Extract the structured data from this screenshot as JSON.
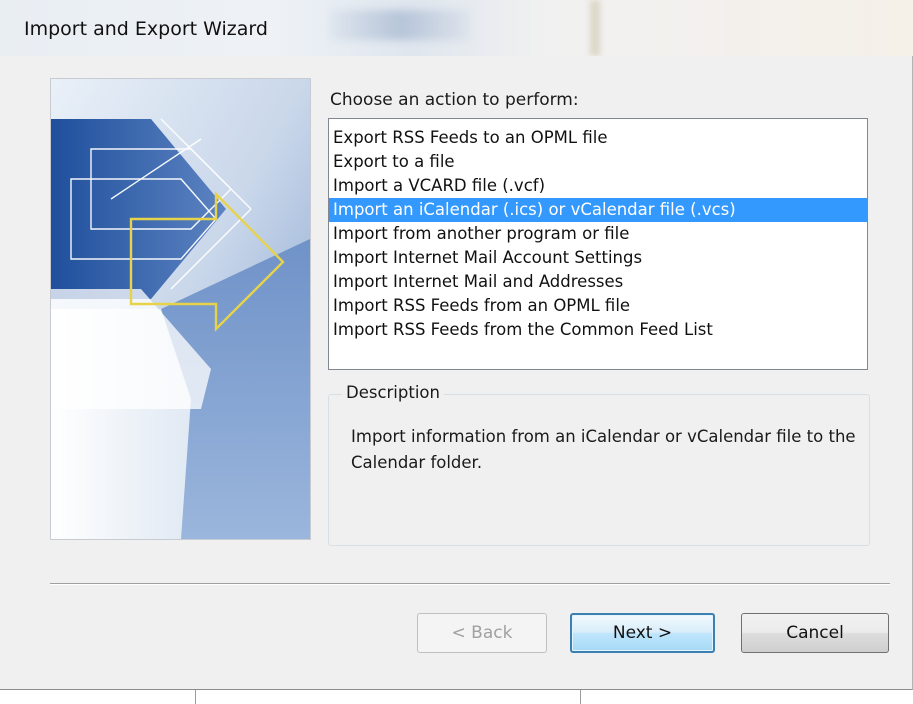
{
  "window": {
    "title": "Import and Export Wizard"
  },
  "wizard": {
    "prompt": "Choose an action to perform:",
    "actions": [
      "Export RSS Feeds to an OPML file",
      "Export to a file",
      "Import a VCARD file (.vcf)",
      "Import an iCalendar (.ics) or vCalendar file (.vcs)",
      "Import from another program or file",
      "Import Internet Mail Account Settings",
      "Import Internet Mail and Addresses",
      "Import RSS Feeds from an OPML file",
      "Import RSS Feeds from the Common Feed List"
    ],
    "selected_action": "Import an iCalendar (.ics) or vCalendar file (.vcs)",
    "description": {
      "label": "Description",
      "text": "Import information from an iCalendar or vCalendar file to the Calendar folder."
    }
  },
  "buttons": {
    "back": "< Back",
    "next": "Next >",
    "cancel": "Cancel"
  },
  "colors": {
    "selection": "#3399ff",
    "art_blue": "#2f5fa8",
    "arrow_yellow": "#e6d34a"
  }
}
